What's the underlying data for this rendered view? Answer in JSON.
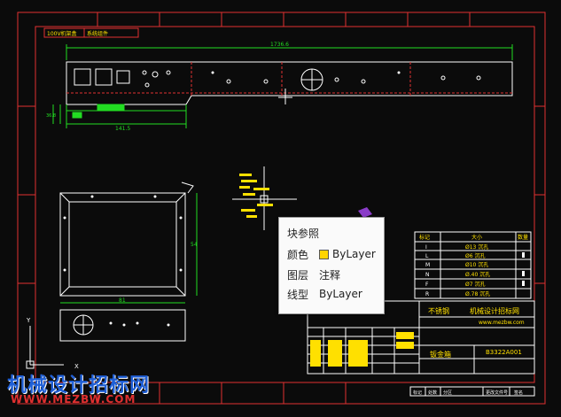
{
  "drawing": {
    "top_left_title": "100V机架盒",
    "top_left_sub": "系统组件",
    "overall_dim": "1736.6",
    "dim_left": "141.5",
    "dim_small": "36.8",
    "dim_front_w": "81",
    "dim_front_h": "54",
    "axis_y": "Y",
    "axis_x": "X"
  },
  "tooltip": {
    "title": "块参照",
    "rows": [
      {
        "key": "颜色",
        "value": "ByLayer",
        "swatch": "#ffd400"
      },
      {
        "key": "图层",
        "value": "注释"
      },
      {
        "key": "线型",
        "value": "ByLayer"
      }
    ]
  },
  "bend_table": {
    "headers": [
      "标记",
      "大小",
      "数量"
    ],
    "rows": [
      {
        "mark": "I",
        "size": "Ø13 沉孔"
      },
      {
        "mark": "L",
        "size": "Ø6 沉孔"
      },
      {
        "mark": "M",
        "size": "Ø10 沉孔"
      },
      {
        "mark": "N",
        "size": "Ø.40 沉孔"
      },
      {
        "mark": "F",
        "size": "Ø7 沉孔"
      },
      {
        "mark": "R",
        "size": "Ø.78 沉孔"
      }
    ]
  },
  "title_block": {
    "material": "不锈钢",
    "company": "机械设计招标网",
    "website": "www.mezbw.com",
    "part_name": "钣金箱",
    "drawing_no": "B3322A001",
    "bottom_labels": [
      "标记",
      "处数",
      "分区",
      "更改文件号",
      "签名"
    ]
  },
  "watermark": {
    "line1": "机械设计招标网",
    "line2": "WWW.MEZBW.COM"
  },
  "colors": {
    "frame": "#e03030",
    "geometry": "#ffffff",
    "dims": "#22dd22",
    "center": "#e03030",
    "text_yellow": "#ffe000"
  }
}
